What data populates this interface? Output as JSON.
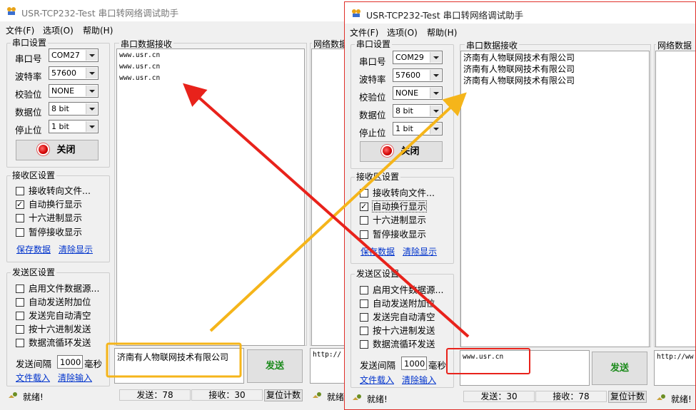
{
  "left": {
    "title": "USR-TCP232-Test 串口转网络调试助手",
    "menu": [
      "文件(F)",
      "选项(O)",
      "帮助(H)"
    ],
    "serial_group": "串口设置",
    "port_label": "串口号",
    "port_value": "COM27",
    "baud_label": "波特率",
    "baud_value": "57600",
    "parity_label": "校验位",
    "parity_value": "NONE",
    "databits_label": "数据位",
    "databits_value": "8 bit",
    "stopbits_label": "停止位",
    "stopbits_value": "1 bit",
    "close_label": "关闭",
    "recv_group": "接收区设置",
    "recv_opts": [
      "接收转向文件...",
      "自动换行显示",
      "十六进制显示",
      "暂停接收显示"
    ],
    "recv_checked": [
      false,
      true,
      false,
      false
    ],
    "save_link": "保存数据",
    "clear_link": "清除显示",
    "send_group": "发送区设置",
    "send_opts": [
      "启用文件数据源...",
      "自动发送附加位",
      "发送完自动清空",
      "按十六进制发送",
      "数据流循环发送"
    ],
    "interval_label": "发送间隔",
    "interval_value": "1000",
    "interval_unit": "毫秒",
    "load_link": "文件载入",
    "clear_input_link": "清除输入",
    "recv_panel": "串口数据接收",
    "recv_lines": [
      "www.usr.cn",
      "www.usr.cn",
      "www.usr.cn"
    ],
    "send_text": "济南有人物联网技术有限公司",
    "send_button": "发送",
    "net_panel": "网络数据",
    "net_send": "http://",
    "status": "就绪!",
    "sent_count": "发送：78",
    "recv_count": "接收：30",
    "reset_button": "复位计数",
    "right_status": "就绪!"
  },
  "right": {
    "title": "USR-TCP232-Test 串口转网络调试助手",
    "menu": [
      "文件(F)",
      "选项(O)",
      "帮助(H)"
    ],
    "serial_group": "串口设置",
    "port_label": "串口号",
    "port_value": "COM29",
    "baud_label": "波特率",
    "baud_value": "57600",
    "parity_label": "校验位",
    "parity_value": "NONE",
    "databits_label": "数据位",
    "databits_value": "8 bit",
    "stopbits_label": "停止位",
    "stopbits_value": "1 bit",
    "close_label": "关闭",
    "recv_group": "接收区设置",
    "recv_opts": [
      "接收转向文件...",
      "自动换行显示",
      "十六进制显示",
      "暂停接收显示"
    ],
    "recv_checked": [
      false,
      true,
      false,
      false
    ],
    "save_link": "保存数据",
    "clear_link": "清除显示",
    "send_group": "发送区设置",
    "send_opts": [
      "启用文件数据源...",
      "自动发送附加位",
      "发送完自动清空",
      "按十六进制发送",
      "数据流循环发送"
    ],
    "interval_label": "发送间隔",
    "interval_value": "1000",
    "interval_unit": "毫秒",
    "load_link": "文件载入",
    "clear_input_link": "清除输入",
    "recv_panel": "串口数据接收",
    "recv_lines": [
      "济南有人物联网技术有限公司",
      "济南有人物联网技术有限公司",
      "济南有人物联网技术有限公司"
    ],
    "send_text": "www.usr.cn",
    "send_button": "发送",
    "net_panel": "网络数据接收",
    "net_send": "http://ww",
    "status": "就绪!",
    "sent_count": "发送：30",
    "recv_count": "接收：78",
    "reset_button": "复位计数",
    "right_status": "就绪!"
  },
  "annotations": {
    "red_arrow_color": "#e8221b",
    "yellow_arrow_color": "#f5b51a",
    "yellow_box_color": "#f5b51a",
    "red_box_color": "#e8221b"
  }
}
